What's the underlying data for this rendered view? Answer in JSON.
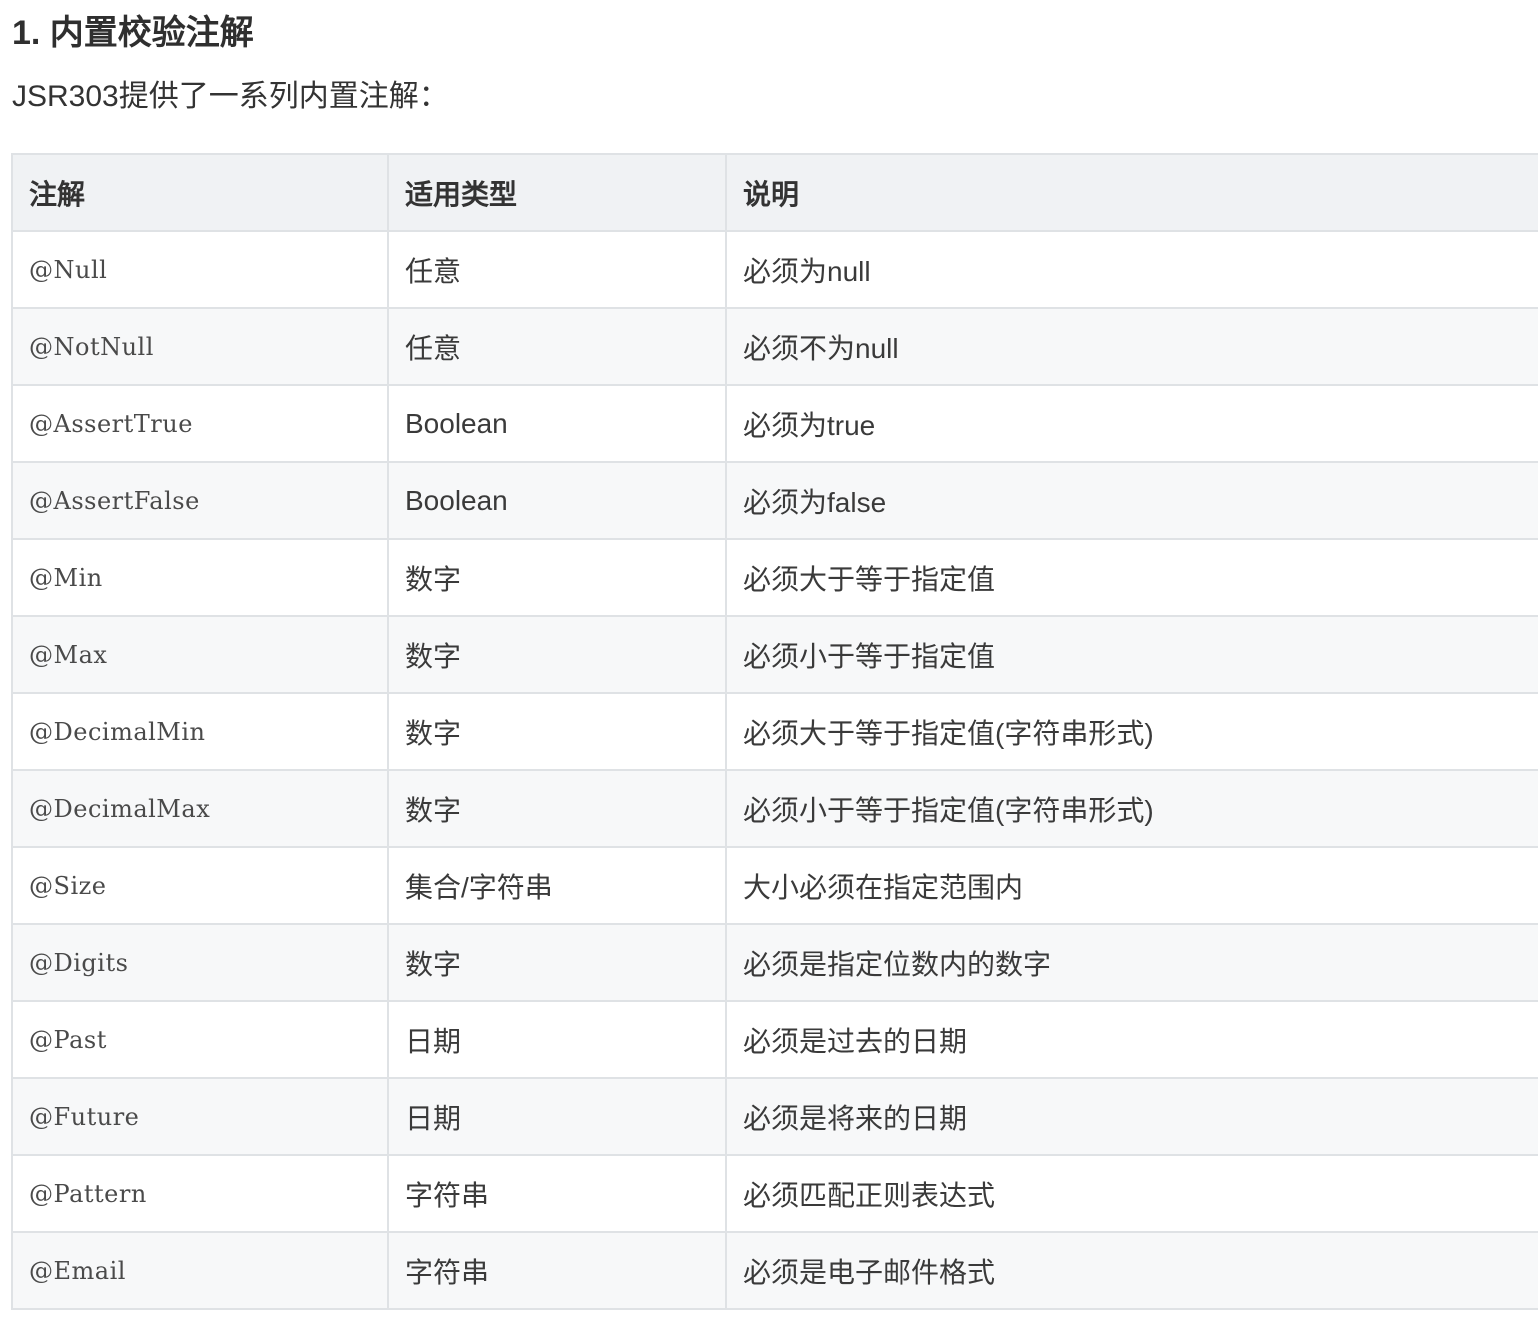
{
  "section": {
    "heading": "1. 内置校验注解",
    "intro": "JSR303提供了一系列内置注解："
  },
  "table": {
    "headers": [
      "注解",
      "适用类型",
      "说明"
    ],
    "rows": [
      {
        "annotation": "@Null",
        "type": "任意",
        "desc": "必须为null"
      },
      {
        "annotation": "@NotNull",
        "type": "任意",
        "desc": "必须不为null"
      },
      {
        "annotation": "@AssertTrue",
        "type": "Boolean",
        "desc": "必须为true"
      },
      {
        "annotation": "@AssertFalse",
        "type": "Boolean",
        "desc": "必须为false"
      },
      {
        "annotation": "@Min",
        "type": "数字",
        "desc": "必须大于等于指定值"
      },
      {
        "annotation": "@Max",
        "type": "数字",
        "desc": "必须小于等于指定值"
      },
      {
        "annotation": "@DecimalMin",
        "type": "数字",
        "desc": "必须大于等于指定值(字符串形式)"
      },
      {
        "annotation": "@DecimalMax",
        "type": "数字",
        "desc": "必须小于等于指定值(字符串形式)"
      },
      {
        "annotation": "@Size",
        "type": "集合/字符串",
        "desc": "大小必须在指定范围内"
      },
      {
        "annotation": "@Digits",
        "type": "数字",
        "desc": "必须是指定位数内的数字"
      },
      {
        "annotation": "@Past",
        "type": "日期",
        "desc": "必须是过去的日期"
      },
      {
        "annotation": "@Future",
        "type": "日期",
        "desc": "必须是将来的日期"
      },
      {
        "annotation": "@Pattern",
        "type": "字符串",
        "desc": "必须匹配正则表达式"
      },
      {
        "annotation": "@Email",
        "type": "字符串",
        "desc": "必须是电子邮件格式"
      }
    ]
  }
}
